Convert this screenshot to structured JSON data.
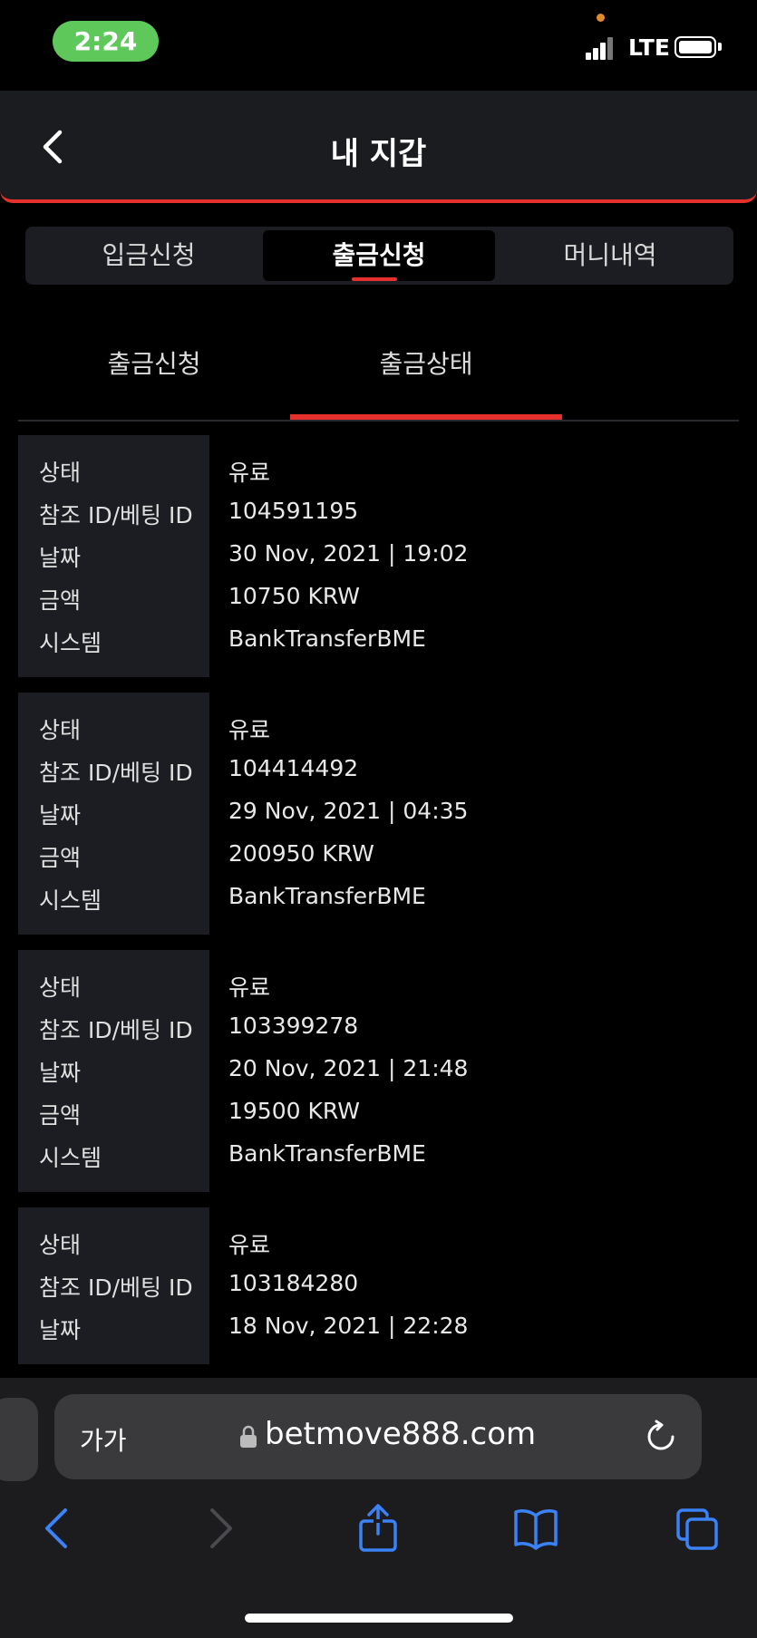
{
  "status_bar": {
    "time": "2:24",
    "network": "LTE"
  },
  "header": {
    "title": "내 지갑"
  },
  "main_tabs": [
    {
      "label": "입금신청"
    },
    {
      "label": "출금신청",
      "active": true
    },
    {
      "label": "머니내역"
    }
  ],
  "sub_tabs": [
    {
      "label": "출금신청"
    },
    {
      "label": "출금상태",
      "active": true
    }
  ],
  "field_labels": {
    "status": "상태",
    "ref_id": "참조 ID/베팅 ID",
    "date": "날짜",
    "amount": "금액",
    "system": "시스템"
  },
  "records": [
    {
      "status": "유료",
      "ref_id": "104591195",
      "date": "30 Nov, 2021 | 19:02",
      "amount": "10750 KRW",
      "system": "BankTransferBME"
    },
    {
      "status": "유료",
      "ref_id": "104414492",
      "date": "29 Nov, 2021 | 04:35",
      "amount": "200950 KRW",
      "system": "BankTransferBME"
    },
    {
      "status": "유료",
      "ref_id": "103399278",
      "date": "20 Nov, 2021 | 21:48",
      "amount": "19500 KRW",
      "system": "BankTransferBME"
    },
    {
      "status": "유료",
      "ref_id": "103184280",
      "date": "18 Nov, 2021 | 22:28"
    }
  ],
  "browser": {
    "text_size_label": "가가",
    "url": "betmove888.com"
  },
  "colors": {
    "accent": "#e5302d",
    "status_pill": "#5ec95a",
    "ios_blue": "#3b82f6"
  }
}
